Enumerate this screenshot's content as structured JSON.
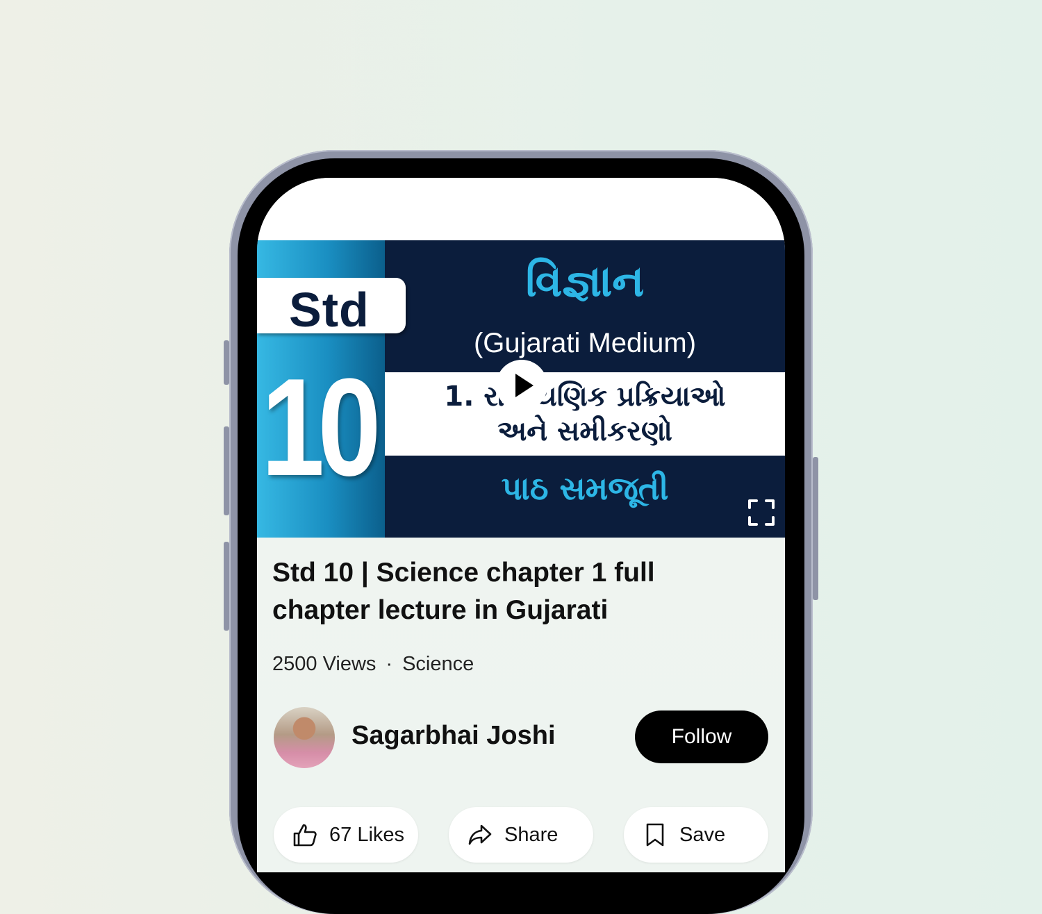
{
  "thumbnail": {
    "std_label": "Std",
    "std_number": "10",
    "title_gujarati": "વિજ્ઞાન",
    "medium": "(Gujarati Medium)",
    "chapter_line1": "1. રાસાયણિક પ્રક્રિયાઓ",
    "chapter_line2": "અને સમીકરણો",
    "explanation": "પાઠ સમજૂતી",
    "colors": {
      "navy": "#0b1d3c",
      "cyan": "#2db6e6"
    }
  },
  "video": {
    "title": "Std 10 | Science chapter 1 full chapter lecture in Gujarati",
    "views": "2500 Views",
    "separator": "·",
    "category": "Science"
  },
  "channel": {
    "name": "Sagarbhai Joshi",
    "follow_label": "Follow"
  },
  "actions": {
    "likes_label": "67 Likes",
    "share_label": "Share",
    "save_label": "Save"
  }
}
